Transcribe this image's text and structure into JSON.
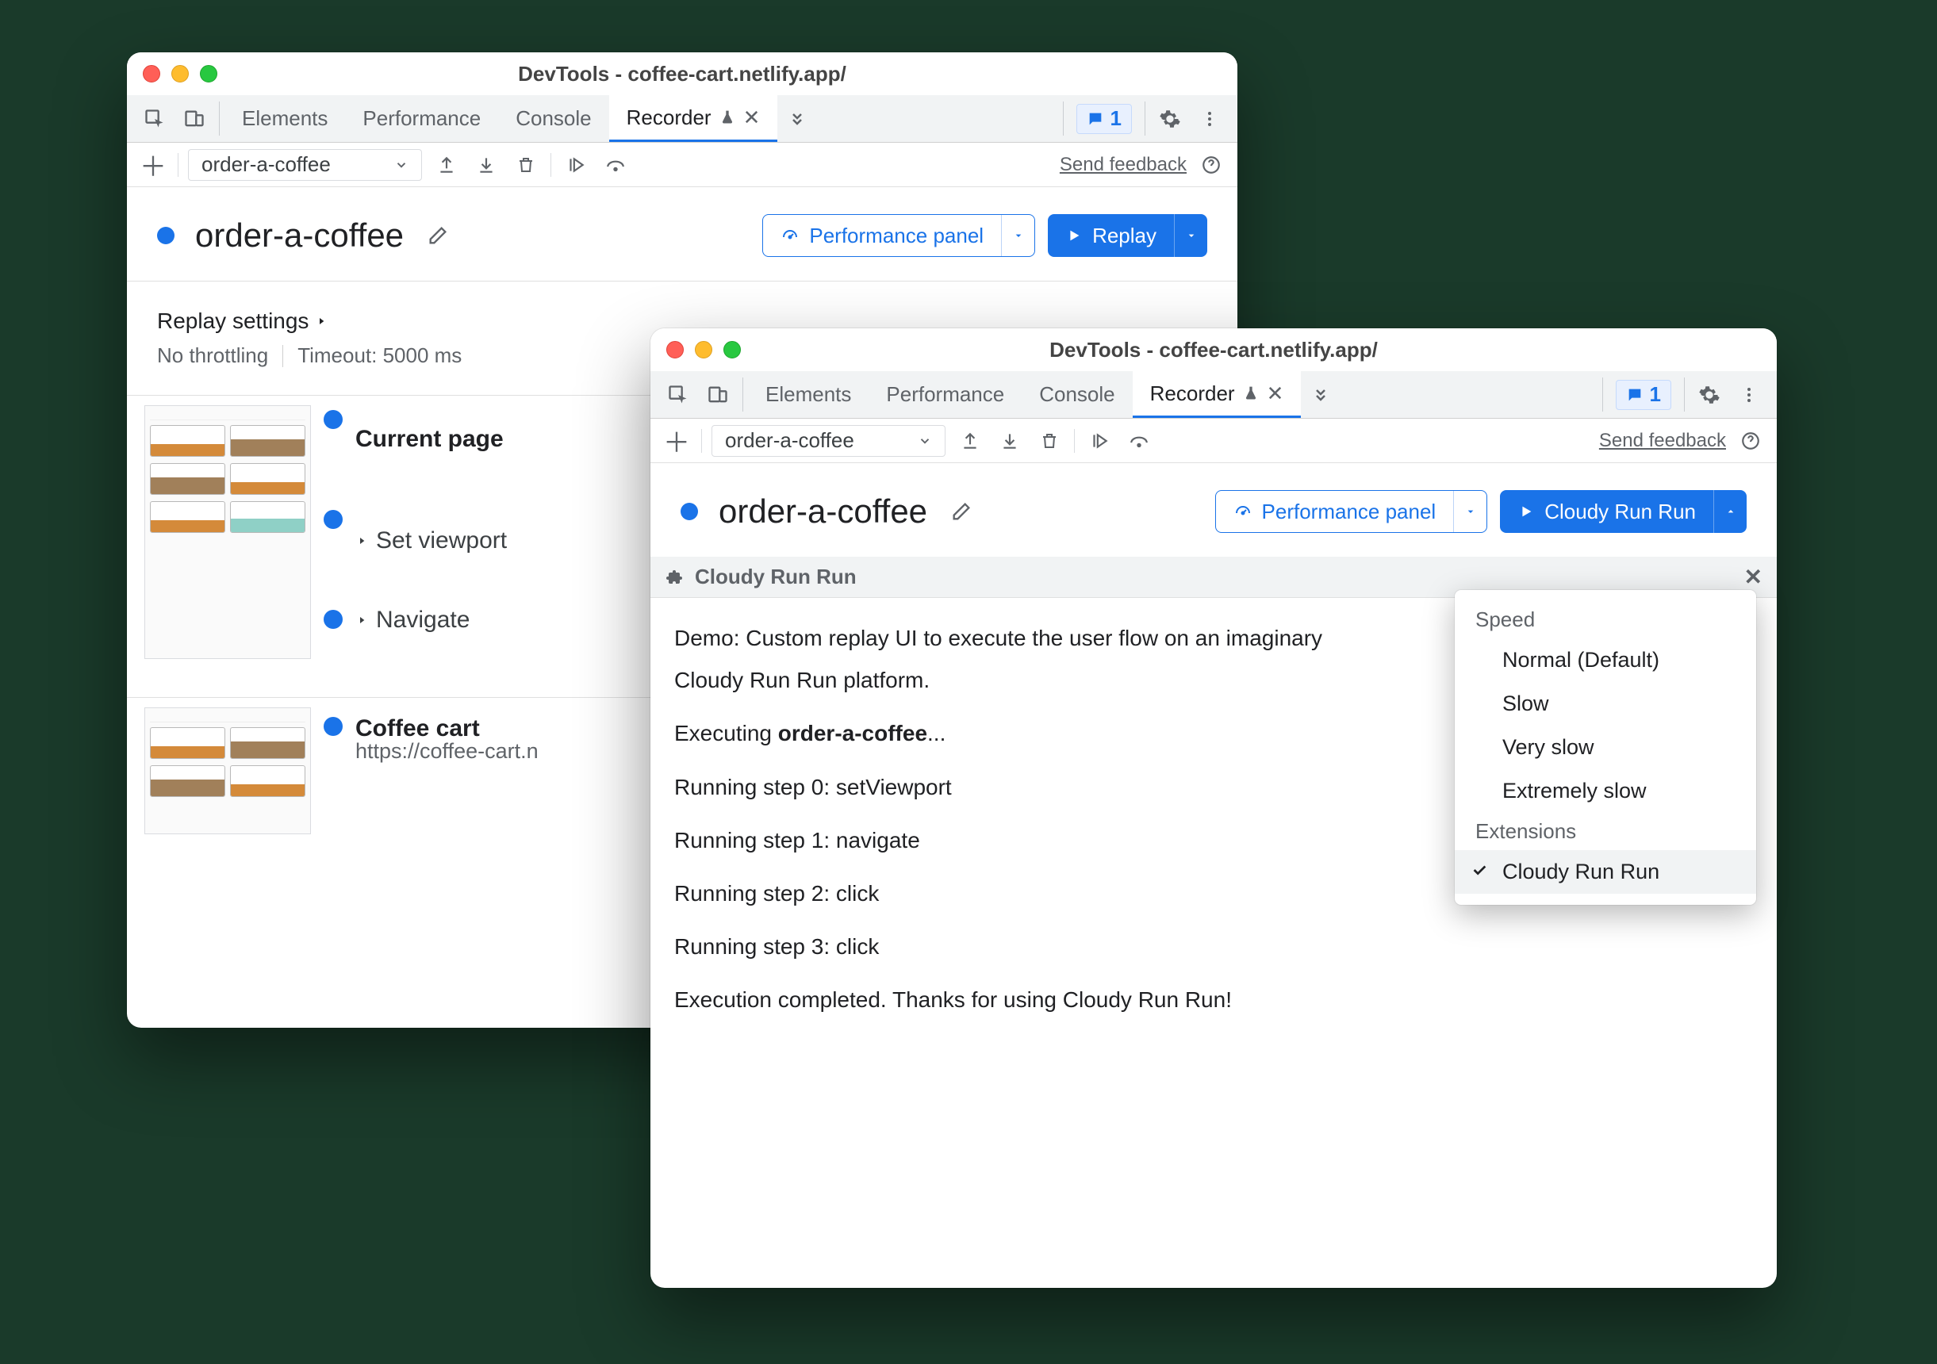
{
  "windowA": {
    "title": "DevTools - coffee-cart.netlify.app/",
    "tabs": [
      "Elements",
      "Performance",
      "Console",
      "Recorder"
    ],
    "issues_count": "1",
    "toolbar": {
      "recording_name": "order-a-coffee",
      "feedback": "Send feedback"
    },
    "header": {
      "title": "order-a-coffee",
      "panel_btn": "Performance panel",
      "action_btn": "Replay"
    },
    "replay_section": {
      "title": "Replay settings",
      "throttle": "No throttling",
      "timeout": "Timeout: 5000 ms"
    },
    "steps": {
      "current": "Current page",
      "set_viewport": "Set viewport",
      "navigate": "Navigate",
      "coffee_title": "Coffee cart",
      "coffee_url": "https://coffee-cart.n"
    }
  },
  "windowB": {
    "title": "DevTools - coffee-cart.netlify.app/",
    "tabs": [
      "Elements",
      "Performance",
      "Console",
      "Recorder"
    ],
    "issues_count": "1",
    "toolbar": {
      "recording_name": "order-a-coffee",
      "feedback": "Send feedback"
    },
    "header": {
      "title": "order-a-coffee",
      "panel_btn": "Performance panel",
      "action_btn": "Cloudy Run Run"
    },
    "panel_title": "Cloudy Run Run",
    "output": {
      "l1_a": "Demo: Custom replay UI to execute the user flow on an imaginary",
      "l1_b": "Cloudy Run Run platform.",
      "l2": "Executing ",
      "l2_bold": "order-a-coffee",
      "l2_end": "...",
      "s0": "Running step 0: setViewport",
      "s1": "Running step 1: navigate",
      "s2": "Running step 2: click",
      "s3": "Running step 3: click",
      "done": "Execution completed. Thanks for using Cloudy Run Run!"
    },
    "menu": {
      "grp1": "Speed",
      "normal": "Normal (Default)",
      "slow": "Slow",
      "very_slow": "Very slow",
      "ex_slow": "Extremely slow",
      "grp2": "Extensions",
      "ext1": "Cloudy Run Run"
    }
  }
}
